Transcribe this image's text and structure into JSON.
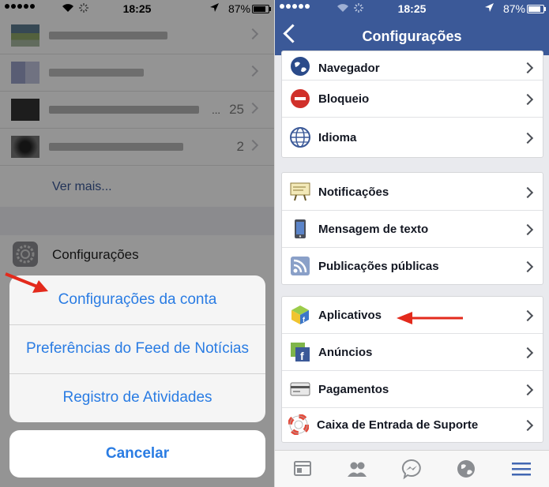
{
  "status": {
    "time": "18:25",
    "battery": "87%"
  },
  "left": {
    "list_rows": [
      {
        "count": ""
      },
      {
        "count": ""
      },
      {
        "count": "25",
        "ellipsis": "..."
      },
      {
        "count": "2"
      }
    ],
    "see_more": "Ver mais...",
    "settings_label": "Configurações",
    "action_sheet": {
      "items": [
        "Configurações da conta",
        "Preferências do Feed de Notícias",
        "Registro de Atividades"
      ],
      "cancel": "Cancelar"
    }
  },
  "right": {
    "title": "Configurações",
    "group1": [
      "Navegador",
      "Bloqueio",
      "Idioma"
    ],
    "group2": [
      "Notificações",
      "Mensagem de texto",
      "Publicações públicas"
    ],
    "group3": [
      "Aplicativos",
      "Anúncios",
      "Pagamentos",
      "Caixa de Entrada de Suporte"
    ],
    "tabs": [
      "news-feed-icon",
      "friends-icon",
      "messenger-icon",
      "globe-icon",
      "menu-icon"
    ]
  },
  "colors": {
    "facebook_blue": "#3b5998",
    "ios_blue": "#2a7ce3",
    "arrow_red": "#e32a1c"
  }
}
